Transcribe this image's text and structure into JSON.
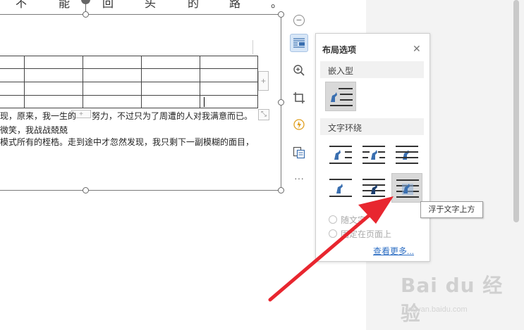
{
  "document": {
    "top_line_chars": [
      "不",
      "能",
      "回",
      "头",
      "的",
      "路",
      "。"
    ],
    "body_lines": [
      "现，原来，我一生的",
      "努力，不过只为了周遭的人对我满意而已。",
      "微笑，我战战兢兢",
      "模式所有的桎梏。走到途中才忽然发现，我只剩下一副模糊的面目，"
    ],
    "row_add_symbol": "+",
    "col_add_symbol": "+",
    "resize_symbol": "⤡"
  },
  "float_toolbar": {
    "minus_symbol": "−",
    "more_symbol": "···",
    "items": [
      "layout-options",
      "zoom",
      "crop",
      "image-tools",
      "convert",
      "more"
    ]
  },
  "layout_panel": {
    "title": "布局选项",
    "close_symbol": "✕",
    "section_inline": "嵌入型",
    "section_wrap": "文字环绕",
    "radio_move_with_text": "随文字",
    "radio_fixed_position": "固定在页面上",
    "see_more": "查看更多..."
  },
  "tooltip": {
    "text": "浮于文字上方"
  },
  "watermark": {
    "logo": "Bai du 经验",
    "url": "jingyan.baidu.com"
  },
  "colors": {
    "accent": "#2f6fc4",
    "arrow": "#e8262f",
    "selected_option": "#d9d9d9",
    "active_tool": "#d7e6f7"
  }
}
